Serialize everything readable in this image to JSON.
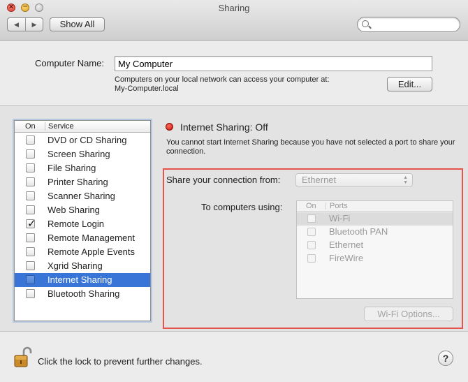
{
  "window": {
    "title": "Sharing",
    "close_glyph": "×",
    "minimize_glyph": "–"
  },
  "toolbar": {
    "back_icon": "◀",
    "forward_icon": "▶",
    "show_all_label": "Show All",
    "search_placeholder": ""
  },
  "computer_name": {
    "label": "Computer Name:",
    "value": "My Computer",
    "info_line1": "Computers on your local network can access your computer at:",
    "info_line2": "My-Computer.local",
    "edit_label": "Edit..."
  },
  "services": {
    "header_on": "On",
    "header_service": "Service",
    "selected_index": 10,
    "items": [
      {
        "name": "DVD or CD Sharing",
        "checked": false
      },
      {
        "name": "Screen Sharing",
        "checked": false
      },
      {
        "name": "File Sharing",
        "checked": false
      },
      {
        "name": "Printer Sharing",
        "checked": false
      },
      {
        "name": "Scanner Sharing",
        "checked": false
      },
      {
        "name": "Web Sharing",
        "checked": false
      },
      {
        "name": "Remote Login",
        "checked": true
      },
      {
        "name": "Remote Management",
        "checked": false
      },
      {
        "name": "Remote Apple Events",
        "checked": false
      },
      {
        "name": "Xgrid Sharing",
        "checked": false
      },
      {
        "name": "Internet Sharing",
        "checked": false
      },
      {
        "name": "Bluetooth Sharing",
        "checked": false
      }
    ]
  },
  "detail": {
    "status": "Internet Sharing: Off",
    "status_color": "#d6251a",
    "description": "You cannot start Internet Sharing because you have not selected a port to share your connection.",
    "share_from_label": "Share your connection from:",
    "share_from_value": "Ethernet",
    "to_computers_label": "To computers using:",
    "ports_header_on": "On",
    "ports_header_ports": "Ports",
    "ports": [
      {
        "name": "Wi-Fi",
        "checked": false
      },
      {
        "name": "Bluetooth PAN",
        "checked": false
      },
      {
        "name": "Ethernet",
        "checked": false
      },
      {
        "name": "FireWire",
        "checked": false
      }
    ],
    "wifi_options_label": "Wi-Fi Options...",
    "highlight_color": "#e4534c"
  },
  "footer": {
    "lock_text": "Click the lock to prevent further changes.",
    "help_label": "?"
  }
}
